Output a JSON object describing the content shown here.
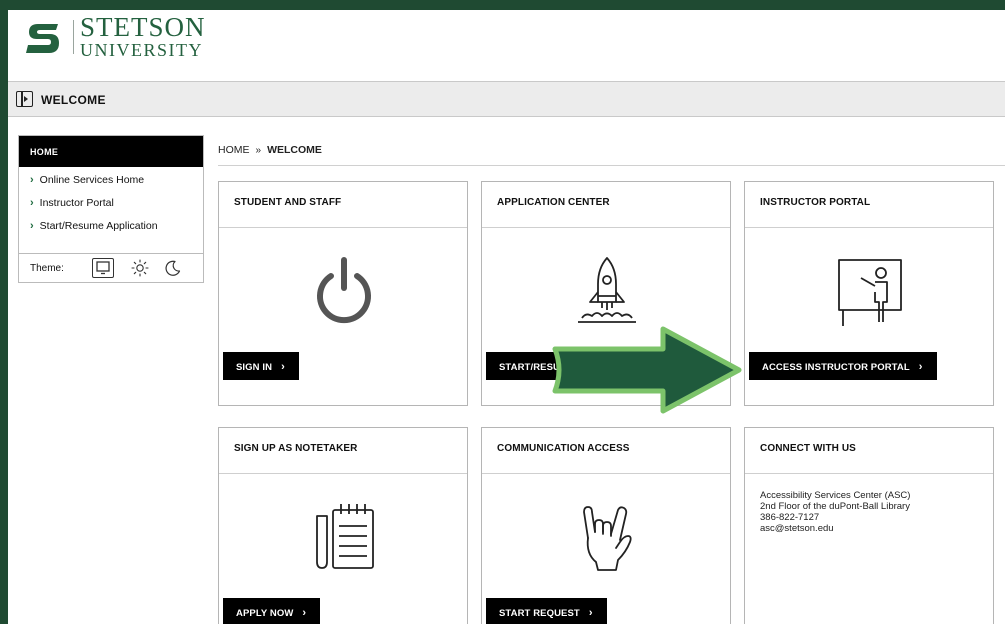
{
  "brand": {
    "line1": "STETSON",
    "line2": "UNIVERSITY",
    "logo_icon": "stetson-s-logo"
  },
  "titlebar": {
    "title": "WELCOME",
    "icon": "panel-toggle-icon"
  },
  "sidebar": {
    "home_label": "HOME",
    "items": [
      {
        "label": "Online Services Home"
      },
      {
        "label": "Instructor Portal"
      },
      {
        "label": "Start/Resume Application"
      }
    ],
    "theme_label": "Theme:",
    "theme_options": [
      "monitor-icon",
      "sun-icon",
      "moon-icon"
    ]
  },
  "breadcrumb": {
    "home": "HOME",
    "separator": "»",
    "current": "WELCOME"
  },
  "cards": {
    "student": {
      "title": "STUDENT AND STAFF",
      "button": "SIGN IN",
      "icon": "power-icon"
    },
    "application": {
      "title": "APPLICATION CENTER",
      "button": "START/RESUME APPLICATION",
      "icon": "rocket-icon"
    },
    "instructor": {
      "title": "INSTRUCTOR PORTAL",
      "button": "ACCESS INSTRUCTOR PORTAL",
      "icon": "presentation-icon"
    },
    "notetaker": {
      "title": "SIGN UP AS NOTETAKER",
      "button": "APPLY NOW",
      "icon": "notepad-icon"
    },
    "communication": {
      "title": "COMMUNICATION ACCESS",
      "button": "START REQUEST",
      "icon": "sign-language-hand-icon"
    },
    "connect": {
      "title": "CONNECT WITH US",
      "lines": [
        "Accessibility Services Center (ASC)",
        "2nd Floor of the duPont-Ball Library",
        "386-822-7127",
        "asc@stetson.edu"
      ]
    }
  },
  "colors": {
    "background": "#1f4a32",
    "brand_green": "#24613f",
    "arrow_fill": "#1f5a3c",
    "arrow_outline": "#7cc36a"
  }
}
